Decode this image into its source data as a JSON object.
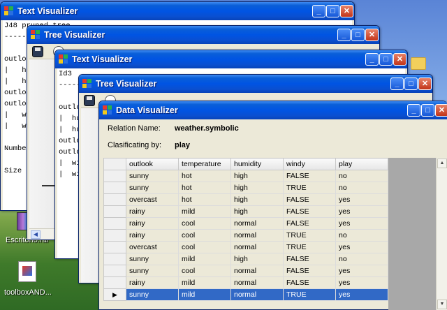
{
  "windows": {
    "text1": {
      "title": "Text Visualizer",
      "lines": [
        "J48 pruned tree",
        "------------------",
        "",
        "outlook",
        "|   humidity",
        "|   humidity",
        "outlook",
        "outlook",
        "|   windy",
        "|   windy",
        "",
        "Number",
        "",
        "Size o"
      ]
    },
    "tree1": {
      "title": "Tree Visualizer"
    },
    "text2": {
      "title": "Text Visualizer",
      "lines": [
        "Id3",
        "------------------",
        "",
        "outlook",
        "|  humi",
        "|  humi",
        "outlook",
        "outlook",
        "|  windy",
        "|  windy"
      ]
    },
    "tree2": {
      "title": "Tree Visualizer"
    },
    "data": {
      "title": "Data Visualizer",
      "relation_label": "Relation Name:",
      "relation_value": "weather.symbolic",
      "class_label": "Clasificating by:",
      "class_value": "play",
      "columns": [
        "outlook",
        "temperature",
        "humidity",
        "windy",
        "play"
      ],
      "rows": [
        [
          "sunny",
          "hot",
          "high",
          "FALSE",
          "no"
        ],
        [
          "sunny",
          "hot",
          "high",
          "TRUE",
          "no"
        ],
        [
          "overcast",
          "hot",
          "high",
          "FALSE",
          "yes"
        ],
        [
          "rainy",
          "mild",
          "high",
          "FALSE",
          "yes"
        ],
        [
          "rainy",
          "cool",
          "normal",
          "FALSE",
          "yes"
        ],
        [
          "rainy",
          "cool",
          "normal",
          "TRUE",
          "no"
        ],
        [
          "overcast",
          "cool",
          "normal",
          "TRUE",
          "yes"
        ],
        [
          "sunny",
          "mild",
          "high",
          "FALSE",
          "no"
        ],
        [
          "sunny",
          "cool",
          "normal",
          "FALSE",
          "yes"
        ],
        [
          "rainy",
          "mild",
          "normal",
          "FALSE",
          "yes"
        ],
        [
          "sunny",
          "mild",
          "normal",
          "TRUE",
          "yes"
        ]
      ],
      "selected_row_index": 10,
      "row_pointer": "▶"
    }
  },
  "controls": {
    "minimize": "_",
    "maximize": "□",
    "close": "✕"
  },
  "desktop": {
    "icon1_label": "Escritorio.rar",
    "icon2_label": "toolboxAND..."
  },
  "colors": {
    "titlebar": "#0054e3",
    "selection": "#3169c6",
    "close_button": "#c2351a"
  }
}
